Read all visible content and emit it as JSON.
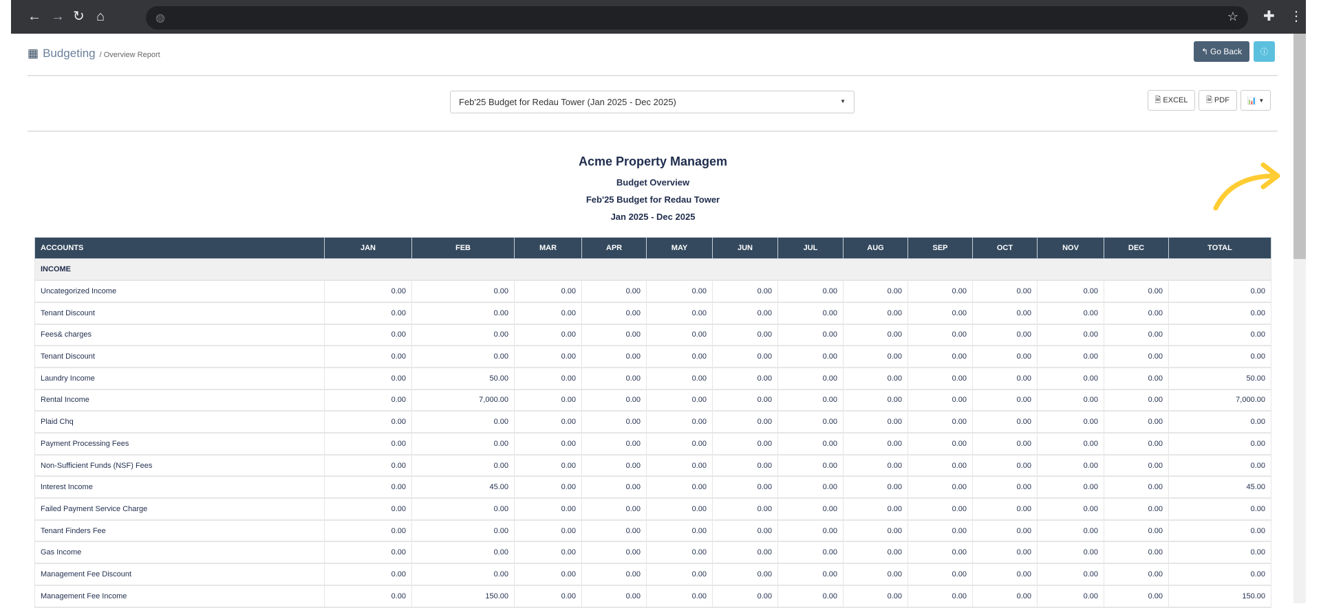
{
  "breadcrumb": {
    "title": "Budgeting",
    "sub": "/ Overview Report"
  },
  "buttons": {
    "go_back": "Go Back",
    "excel": "EXCEL",
    "pdf": "PDF"
  },
  "select": {
    "value": "Feb'25 Budget for Redau Tower (Jan 2025 - Dec 2025)"
  },
  "report": {
    "company": "Acme Property Managem",
    "subtitle": "Budget Overview",
    "budget": "Feb'25 Budget for Redau Tower",
    "period": "Jan 2025 - Dec 2025"
  },
  "colors": {
    "header": "#34495e",
    "info": "#5bc0de",
    "arrow": "#ffcc33"
  },
  "table": {
    "columns": [
      "ACCOUNTS",
      "JAN",
      "FEB",
      "MAR",
      "APR",
      "MAY",
      "JUN",
      "JUL",
      "AUG",
      "SEP",
      "OCT",
      "NOV",
      "DEC",
      "TOTAL"
    ],
    "section": "INCOME",
    "rows": [
      [
        "Uncategorized Income",
        "0.00",
        "0.00",
        "0.00",
        "0.00",
        "0.00",
        "0.00",
        "0.00",
        "0.00",
        "0.00",
        "0.00",
        "0.00",
        "0.00",
        "0.00"
      ],
      [
        "Tenant Discount",
        "0.00",
        "0.00",
        "0.00",
        "0.00",
        "0.00",
        "0.00",
        "0.00",
        "0.00",
        "0.00",
        "0.00",
        "0.00",
        "0.00",
        "0.00"
      ],
      [
        "Fees& charges",
        "0.00",
        "0.00",
        "0.00",
        "0.00",
        "0.00",
        "0.00",
        "0.00",
        "0.00",
        "0.00",
        "0.00",
        "0.00",
        "0.00",
        "0.00"
      ],
      [
        "Tenant Discount",
        "0.00",
        "0.00",
        "0.00",
        "0.00",
        "0.00",
        "0.00",
        "0.00",
        "0.00",
        "0.00",
        "0.00",
        "0.00",
        "0.00",
        "0.00"
      ],
      [
        "Laundry Income",
        "0.00",
        "50.00",
        "0.00",
        "0.00",
        "0.00",
        "0.00",
        "0.00",
        "0.00",
        "0.00",
        "0.00",
        "0.00",
        "0.00",
        "50.00"
      ],
      [
        "Rental Income",
        "0.00",
        "7,000.00",
        "0.00",
        "0.00",
        "0.00",
        "0.00",
        "0.00",
        "0.00",
        "0.00",
        "0.00",
        "0.00",
        "0.00",
        "7,000.00"
      ],
      [
        "Plaid Chq",
        "0.00",
        "0.00",
        "0.00",
        "0.00",
        "0.00",
        "0.00",
        "0.00",
        "0.00",
        "0.00",
        "0.00",
        "0.00",
        "0.00",
        "0.00"
      ],
      [
        "Payment Processing Fees",
        "0.00",
        "0.00",
        "0.00",
        "0.00",
        "0.00",
        "0.00",
        "0.00",
        "0.00",
        "0.00",
        "0.00",
        "0.00",
        "0.00",
        "0.00"
      ],
      [
        "Non-Sufficient Funds (NSF) Fees",
        "0.00",
        "0.00",
        "0.00",
        "0.00",
        "0.00",
        "0.00",
        "0.00",
        "0.00",
        "0.00",
        "0.00",
        "0.00",
        "0.00",
        "0.00"
      ],
      [
        "Interest Income",
        "0.00",
        "45.00",
        "0.00",
        "0.00",
        "0.00",
        "0.00",
        "0.00",
        "0.00",
        "0.00",
        "0.00",
        "0.00",
        "0.00",
        "45.00"
      ],
      [
        "Failed Payment Service Charge",
        "0.00",
        "0.00",
        "0.00",
        "0.00",
        "0.00",
        "0.00",
        "0.00",
        "0.00",
        "0.00",
        "0.00",
        "0.00",
        "0.00",
        "0.00"
      ],
      [
        "Tenant Finders Fee",
        "0.00",
        "0.00",
        "0.00",
        "0.00",
        "0.00",
        "0.00",
        "0.00",
        "0.00",
        "0.00",
        "0.00",
        "0.00",
        "0.00",
        "0.00"
      ],
      [
        "Gas Income",
        "0.00",
        "0.00",
        "0.00",
        "0.00",
        "0.00",
        "0.00",
        "0.00",
        "0.00",
        "0.00",
        "0.00",
        "0.00",
        "0.00",
        "0.00"
      ],
      [
        "Management Fee Discount",
        "0.00",
        "0.00",
        "0.00",
        "0.00",
        "0.00",
        "0.00",
        "0.00",
        "0.00",
        "0.00",
        "0.00",
        "0.00",
        "0.00",
        "0.00"
      ],
      [
        "Management Fee Income",
        "0.00",
        "150.00",
        "0.00",
        "0.00",
        "0.00",
        "0.00",
        "0.00",
        "0.00",
        "0.00",
        "0.00",
        "0.00",
        "0.00",
        "150.00"
      ]
    ]
  }
}
